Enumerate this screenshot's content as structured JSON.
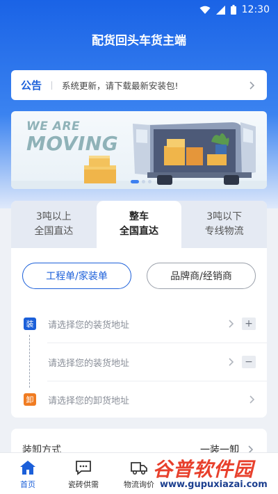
{
  "status_bar": {
    "time": "12:30"
  },
  "header": {
    "title": "配货回头车货主端"
  },
  "notice": {
    "tag": "公告",
    "text": "系统更新，请下载最新安装包!"
  },
  "banner": {
    "line1": "WE ARE",
    "line2": "MOVING",
    "slide_count": 3,
    "active_slide": 1
  },
  "tabs": [
    {
      "line1": "3吨以上",
      "line2": "全国直达",
      "active": false
    },
    {
      "line1": "整车",
      "line2": "全国直达",
      "active": true
    },
    {
      "line1": "3吨以下",
      "line2": "专线物流",
      "active": false
    }
  ],
  "buttons": {
    "primary": "工程单/家装单",
    "secondary": "品牌商/经销商"
  },
  "addresses": {
    "load_badge": "装",
    "unload_badge": "卸",
    "load1_placeholder": "请选择您的装货地址",
    "load2_placeholder": "请选择您的装货地址",
    "unload_placeholder": "请选择您的卸货地址",
    "add_symbol": "+",
    "remove_symbol": "−"
  },
  "method": {
    "label": "装卸方式",
    "value": "一装一卸"
  },
  "bottom_nav": [
    {
      "label": "首页",
      "icon": "home-icon",
      "active": true
    },
    {
      "label": "瓷砖供需",
      "icon": "chat-icon",
      "active": false
    },
    {
      "label": "物流询价",
      "icon": "truck-icon",
      "active": false
    }
  ],
  "watermark": {
    "text": "谷普软件园",
    "url": "www.gupuxiazai.com"
  },
  "colors": {
    "primary": "#1b5fd9",
    "load_badge": "#1b5fd9",
    "unload_badge": "#f07c22"
  }
}
